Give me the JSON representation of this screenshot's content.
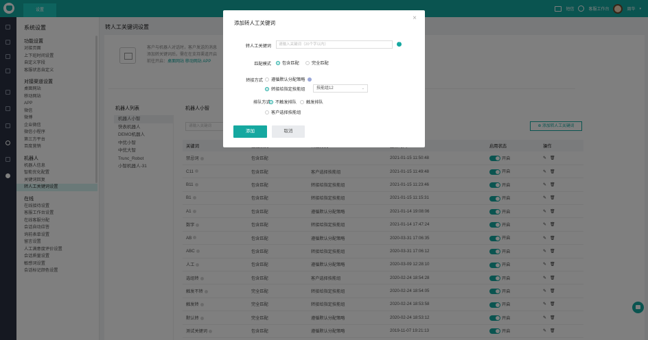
{
  "topbar": {
    "tab": "设置",
    "right": [
      "短信",
      "客服工作台",
      "周华"
    ]
  },
  "menu": {
    "title": "系统设置",
    "groups": [
      {
        "label": "功能设置",
        "items": [
          "对接页面",
          "上下班时间设置",
          "自定义字段",
          "客服状态自定义"
        ]
      },
      {
        "label": "对接渠道设置",
        "items": [
          "桌面网站",
          "移动网站",
          "APP",
          "微信",
          "微博",
          "企业微信",
          "微信小程序",
          "第三方平台",
          "百度营销"
        ]
      },
      {
        "label": "机器人",
        "items": [
          "机器人信息",
          "智能优化配置",
          "关键词回复",
          "转人工关键词设置"
        ]
      },
      {
        "label": "在线",
        "items": [
          "在线接待设置",
          "客服工作台设置",
          "在线客服分配",
          "会话自动应答",
          "询前表单设置",
          "留言设置",
          "人工满意度评价设置",
          "会话质量设置",
          "敏感词设置",
          "会话标记颜色设置"
        ]
      }
    ],
    "active": "转人工关键词设置"
  },
  "main": {
    "breadcrumb": "转人工关键词设置",
    "hint_lines": [
      "客户与机器人对话时，客户发送的消息",
      "添加转关键词后，需在在支持渠道开启",
      "前往开启："
    ],
    "hint_links": [
      "桌面网站",
      "移动网站",
      "APP"
    ],
    "robots_header": "机器人列表",
    "robots": [
      "机器人小智",
      "快表机器人",
      "DEMO机器人",
      "中优小智",
      "中优大智",
      "Trunc_Robot",
      "小智机器人-31"
    ],
    "robots_active": "机器人小智",
    "kw_header": "机器人小智",
    "search_placeholder": "请输入关键词",
    "add_button": "添加转人工关键词",
    "columns": [
      "关键词",
      "匹配模式",
      "转接方式",
      "更新时间",
      "启用状态",
      "操作"
    ],
    "rows": [
      {
        "kw": "禁忌词",
        "mode": "包含匹配",
        "way": "",
        "time": "2021-01-15 11:50:48",
        "status": "开启"
      },
      {
        "kw": "C11",
        "mode": "包含匹配",
        "way": "客户选择技能组",
        "time": "2021-01-15 11:49:48",
        "status": "开启"
      },
      {
        "kw": "B11",
        "mode": "包含匹配",
        "way": "转接给指定技能组",
        "time": "2021-01-15 11:23:46",
        "status": "开启"
      },
      {
        "kw": "B1",
        "mode": "包含匹配",
        "way": "转接给指定技能组",
        "time": "2021-01-15 11:15:31",
        "status": "开启"
      },
      {
        "kw": "A1",
        "mode": "包含匹配",
        "way": "遵循默认分配策略",
        "time": "2021-01-14 19:08:06",
        "status": "开启"
      },
      {
        "kw": "数字",
        "mode": "包含匹配",
        "way": "转接给指定技能组",
        "time": "2021-01-14 17:47:24",
        "status": "开启"
      },
      {
        "kw": "AB",
        "mode": "包含匹配",
        "way": "遵循默认分配策略",
        "time": "2020-03-31 17:06:35",
        "status": "开启"
      },
      {
        "kw": "ABC",
        "mode": "包含匹配",
        "way": "转接给指定技能组",
        "time": "2020-03-31 17:06:12",
        "status": "开启"
      },
      {
        "kw": "人工",
        "mode": "包含匹配",
        "way": "遵循默认分配策略",
        "time": "2020-03-09 12:28:10",
        "status": "开启"
      },
      {
        "kw": "选组转",
        "mode": "包含匹配",
        "way": "客户选择技能组",
        "time": "2020-02-24 18:54:28",
        "status": "开启"
      },
      {
        "kw": "触发不转",
        "mode": "完全匹配",
        "way": "转接给指定技能组",
        "time": "2020-02-24 18:54:05",
        "status": "开启"
      },
      {
        "kw": "触发转",
        "mode": "完全匹配",
        "way": "转接给指定技能组",
        "time": "2020-02-24 18:53:58",
        "status": "开启"
      },
      {
        "kw": "默认转",
        "mode": "完全匹配",
        "way": "遵循默认分配策略",
        "time": "2020-02-24 18:53:12",
        "status": "开启"
      },
      {
        "kw": "测试关键词",
        "mode": "包含匹配",
        "way": "遵循默认分配策略",
        "time": "2019-11-07 19:21:13",
        "status": "开启"
      },
      {
        "kw": "键盘侠",
        "mode": "包含匹配",
        "way": "遵循默认分配策略",
        "time": "2019-07-16 15:26:05",
        "status": "开启"
      }
    ],
    "op_edit": "✎",
    "op_delete": "🗑"
  },
  "dialog": {
    "title": "添加转人工关键词",
    "close": "×",
    "kw_label": "转人工关键词",
    "kw_placeholder": "请输入关键词（20个字以内）",
    "mode_label": "匹配模式",
    "mode_contains": "包含匹配",
    "mode_exact": "完全匹配",
    "way_label": "转接方式",
    "way_default": "遵循默认分配策略",
    "way_group": "转接给指定技能组",
    "group_value": "技能组12",
    "queue_label": "排队方式",
    "queue_no": "不触发排队",
    "queue_yes": "触发排队",
    "way_customer": "客户选择技能组",
    "btn_add": "添加",
    "btn_cancel": "取消"
  },
  "colors": {
    "accent": "#15a8a0",
    "rail": "#2a3142"
  }
}
